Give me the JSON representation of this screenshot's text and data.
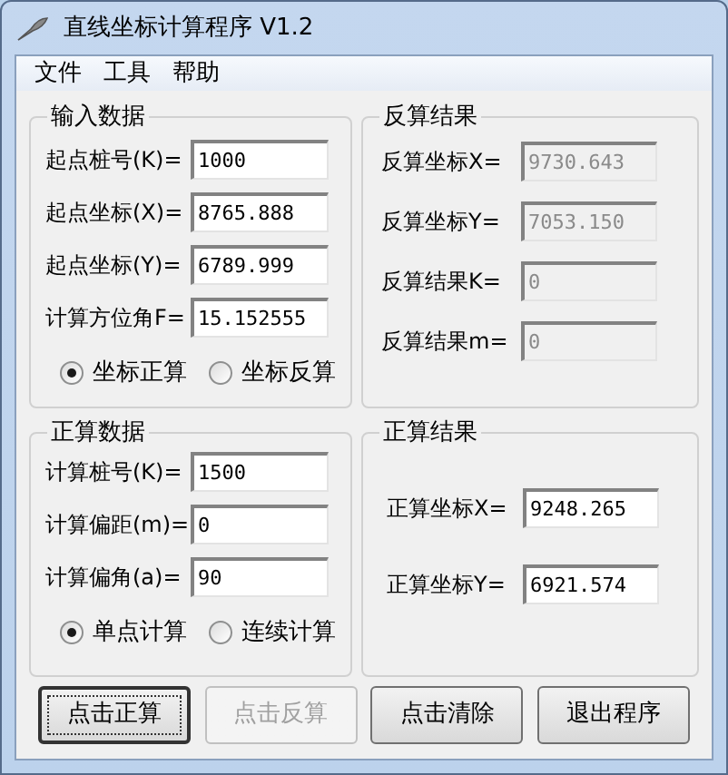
{
  "window": {
    "title": "直线坐标计算程序 V1.2"
  },
  "menu": [
    "文件",
    "工具",
    "帮助"
  ],
  "input_data": {
    "title": "输入数据",
    "fields": [
      {
        "label": "起点桩号(K)=",
        "value": "1000",
        "disabled": false
      },
      {
        "label": "起点坐标(X)=",
        "value": "8765.888",
        "disabled": false
      },
      {
        "label": "起点坐标(Y)=",
        "value": "6789.999",
        "disabled": false
      },
      {
        "label": "计算方位角F=",
        "value": "15.152555",
        "disabled": false
      }
    ],
    "radios": [
      {
        "label": "坐标正算",
        "selected": true
      },
      {
        "label": "坐标反算",
        "selected": false
      }
    ]
  },
  "inverse_results": {
    "title": "反算结果",
    "fields": [
      {
        "label": "反算坐标X=",
        "value": "9730.643",
        "disabled": true
      },
      {
        "label": "反算坐标Y=",
        "value": "7053.150",
        "disabled": true
      },
      {
        "label": "反算结果K=",
        "value": "0",
        "disabled": true
      },
      {
        "label": "反算结果m=",
        "value": "0",
        "disabled": true
      }
    ]
  },
  "forward_data": {
    "title": "正算数据",
    "fields": [
      {
        "label": "计算桩号(K)=",
        "value": "1500",
        "disabled": false
      },
      {
        "label": "计算偏距(m)=",
        "value": "0",
        "disabled": false
      },
      {
        "label": "计算偏角(a)=",
        "value": "90",
        "disabled": false
      }
    ],
    "radios": [
      {
        "label": "单点计算",
        "selected": true
      },
      {
        "label": "连续计算",
        "selected": false
      }
    ]
  },
  "forward_results": {
    "title": "正算结果",
    "fields": [
      {
        "label": "正算坐标X=",
        "value": "9248.265",
        "disabled": false
      },
      {
        "label": "正算坐标Y=",
        "value": "6921.574",
        "disabled": false
      }
    ]
  },
  "buttons": [
    {
      "label": "点击正算",
      "disabled": false,
      "focused": true
    },
    {
      "label": "点击反算",
      "disabled": true,
      "focused": false
    },
    {
      "label": "点击清除",
      "disabled": false,
      "focused": false
    },
    {
      "label": "退出程序",
      "disabled": false,
      "focused": false
    }
  ]
}
